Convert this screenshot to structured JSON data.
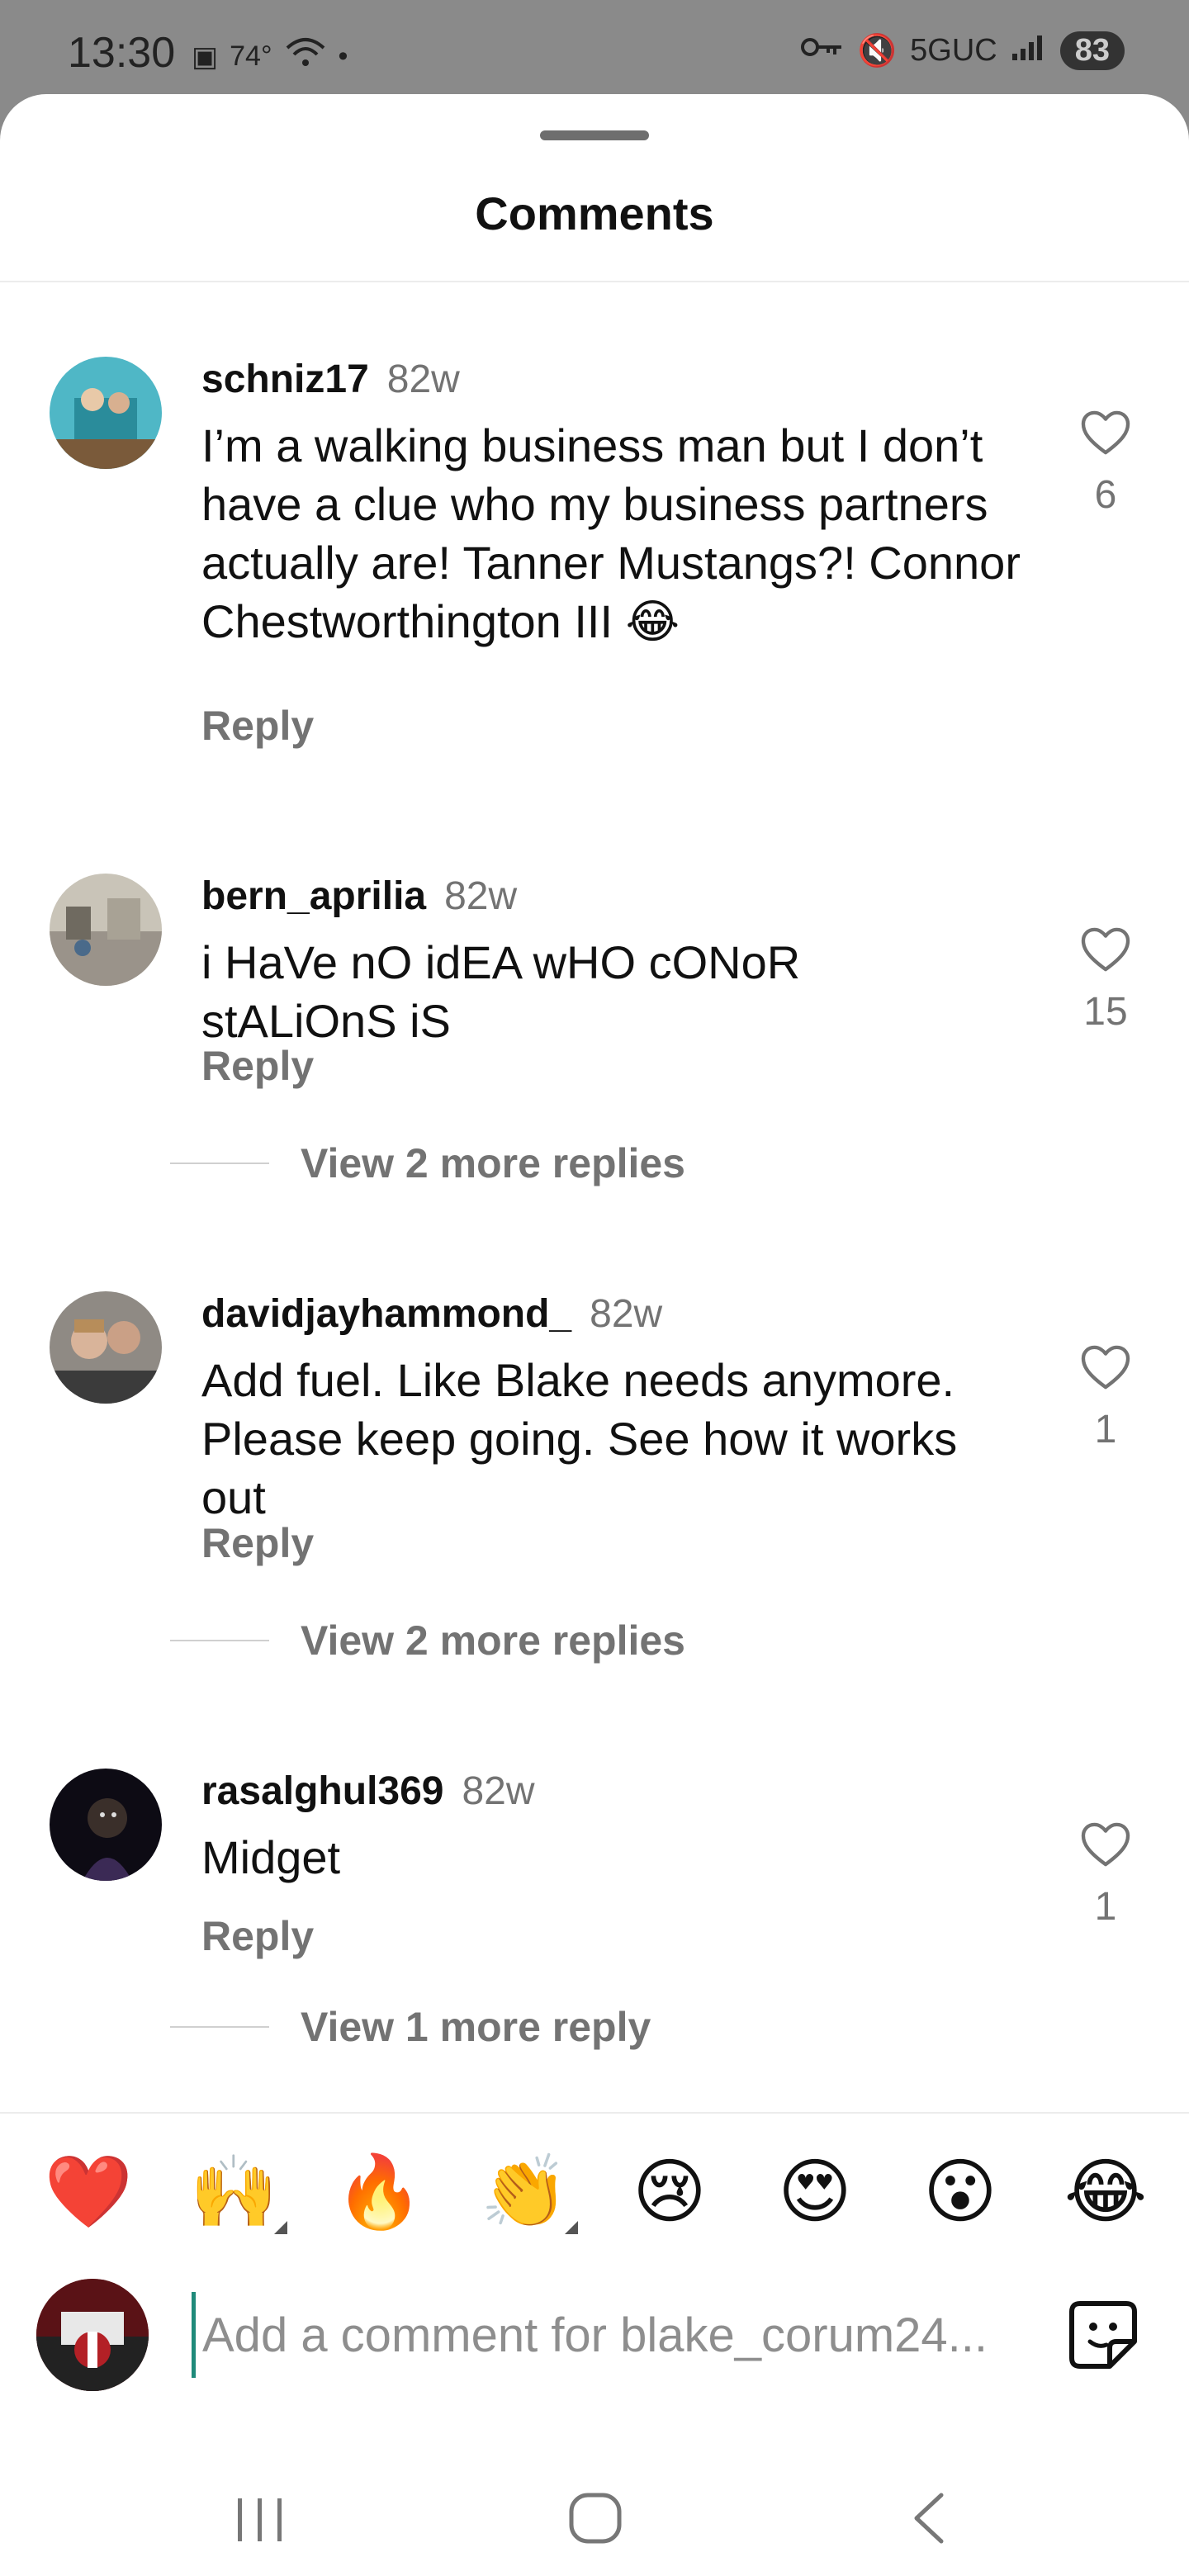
{
  "status_bar": {
    "time": "13:30",
    "temperature": "74°",
    "network": "5GUC",
    "battery": "83"
  },
  "sheet": {
    "title": "Comments"
  },
  "comments": [
    {
      "username": "schniz17",
      "time": "82w",
      "text": "I’m a walking business man but I don’t have a clue who my business partners actually are! Tanner Mustangs?! Connor Chestworthington III 😂",
      "reply_label": "Reply",
      "likes": "6"
    },
    {
      "username": "bern_aprilia",
      "time": "82w",
      "text": "i HaVe nO idEA wHO cONoR stALiOnS iS",
      "reply_label": "Reply",
      "likes": "15",
      "view_replies": "View 2 more replies"
    },
    {
      "username": "davidjayhammond_",
      "time": "82w",
      "text": "Add fuel. Like Blake needs anymore. Please keep going. See how it works out",
      "reply_label": "Reply",
      "likes": "1",
      "view_replies": "View 2 more replies"
    },
    {
      "username": "rasalghul369",
      "time": "82w",
      "text": "Midget",
      "reply_label": "Reply",
      "likes": "1",
      "view_replies": "View 1 more reply"
    }
  ],
  "emoji_bar": [
    "❤️",
    "🙌",
    "🔥",
    "👏",
    "😢",
    "😍",
    "😮",
    "😂"
  ],
  "input": {
    "placeholder": "Add a comment for blake_corum24..."
  },
  "icons": {
    "like": "heart-outline-icon",
    "sticker": "sticker-icon",
    "nav": [
      "recent-apps-icon",
      "home-icon",
      "back-icon"
    ]
  }
}
